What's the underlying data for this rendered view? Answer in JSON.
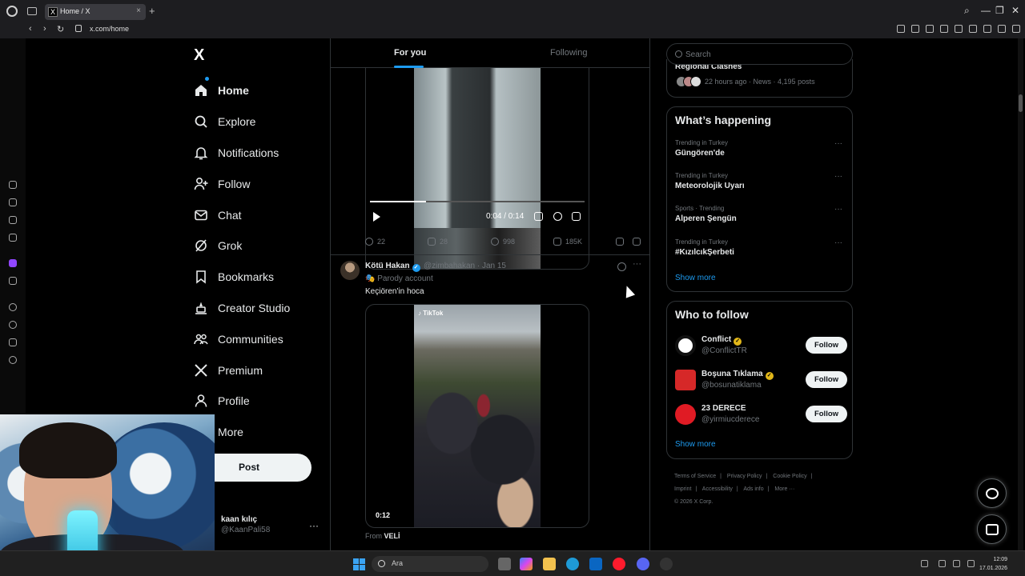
{
  "browser": {
    "tab_title": "Home / X",
    "tab_favicon": "X",
    "url": "x.com/home",
    "new_tab_symbol": "+"
  },
  "nav": {
    "logo": "X",
    "items": [
      {
        "label": "Home",
        "icon": "home-icon",
        "active": true
      },
      {
        "label": "Explore",
        "icon": "search-icon"
      },
      {
        "label": "Notifications",
        "icon": "bell-icon"
      },
      {
        "label": "Follow",
        "icon": "person-add-icon"
      },
      {
        "label": "Chat",
        "icon": "mail-icon"
      },
      {
        "label": "Grok",
        "icon": "grok-icon"
      },
      {
        "label": "Bookmarks",
        "icon": "bookmark-icon"
      },
      {
        "label": "Creator Studio",
        "icon": "creator-studio-icon"
      },
      {
        "label": "Communities",
        "icon": "communities-icon"
      },
      {
        "label": "Premium",
        "icon": "x-premium-icon"
      },
      {
        "label": "Profile",
        "icon": "profile-icon"
      },
      {
        "label": "More",
        "icon": "more-circle-icon"
      }
    ],
    "post_label": "Post",
    "user": {
      "name": "kaan kılıç",
      "handle": "@KaanPali58",
      "more": "···"
    }
  },
  "timeline": {
    "tabs": {
      "for_you": "For you",
      "following": "Following"
    },
    "tweet1": {
      "video_time": "0:04 / 0:14",
      "progress": 0.26,
      "replies": "22",
      "reposts": "28",
      "likes": "998",
      "views": "185K"
    },
    "tweet2": {
      "name": "Kötü Hakan",
      "handle": "@zimbahakan · Jan 15",
      "label": "Parody account",
      "text": "Keçiören'in hoca",
      "video_watermark": "TikTok",
      "video_duration": "0:12",
      "from_prefix": "From",
      "from_source": "VELİ",
      "more": "···"
    }
  },
  "sidebar": {
    "search_placeholder": "Search",
    "top_card": {
      "title": "Regional Clashes",
      "meta": "22 hours ago · News · 4,195 posts"
    },
    "happening": {
      "title": "What’s happening",
      "trends": [
        {
          "context": "Trending in Turkey",
          "title": "Güngören'de"
        },
        {
          "context": "Trending in Turkey",
          "title": "Meteorolojik Uyarı"
        },
        {
          "context": "Sports · Trending",
          "title": "Alperen Şengün"
        },
        {
          "context": "Trending in Turkey",
          "title": "#KızılcıkŞerbeti"
        }
      ],
      "more_symbol": "···",
      "show_more": "Show more"
    },
    "who_to_follow": {
      "title": "Who to follow",
      "accounts": [
        {
          "name": "Conflict",
          "handle": "@ConflictTR",
          "button": "Follow"
        },
        {
          "name": "Boşuna Tıklama",
          "handle": "@bosunatiklama",
          "button": "Follow"
        },
        {
          "name": "23 DERECE",
          "handle": "@yirmiucderece",
          "button": "Follow"
        }
      ],
      "show_more": "Show more"
    },
    "footer": {
      "links": [
        "Terms of Service",
        "Privacy Policy",
        "Cookie Policy",
        "Imprint",
        "Accessibility",
        "Ads info",
        "More ···"
      ],
      "separator": "|",
      "copyright": "© 2026 X Corp."
    }
  },
  "taskbar": {
    "search_text": "Ara",
    "time": "12:09",
    "date": "17.01.2026"
  },
  "colors": {
    "accent": "#1d9bf0",
    "background": "#000000",
    "border": "#2f3336",
    "muted": "#71767b"
  }
}
